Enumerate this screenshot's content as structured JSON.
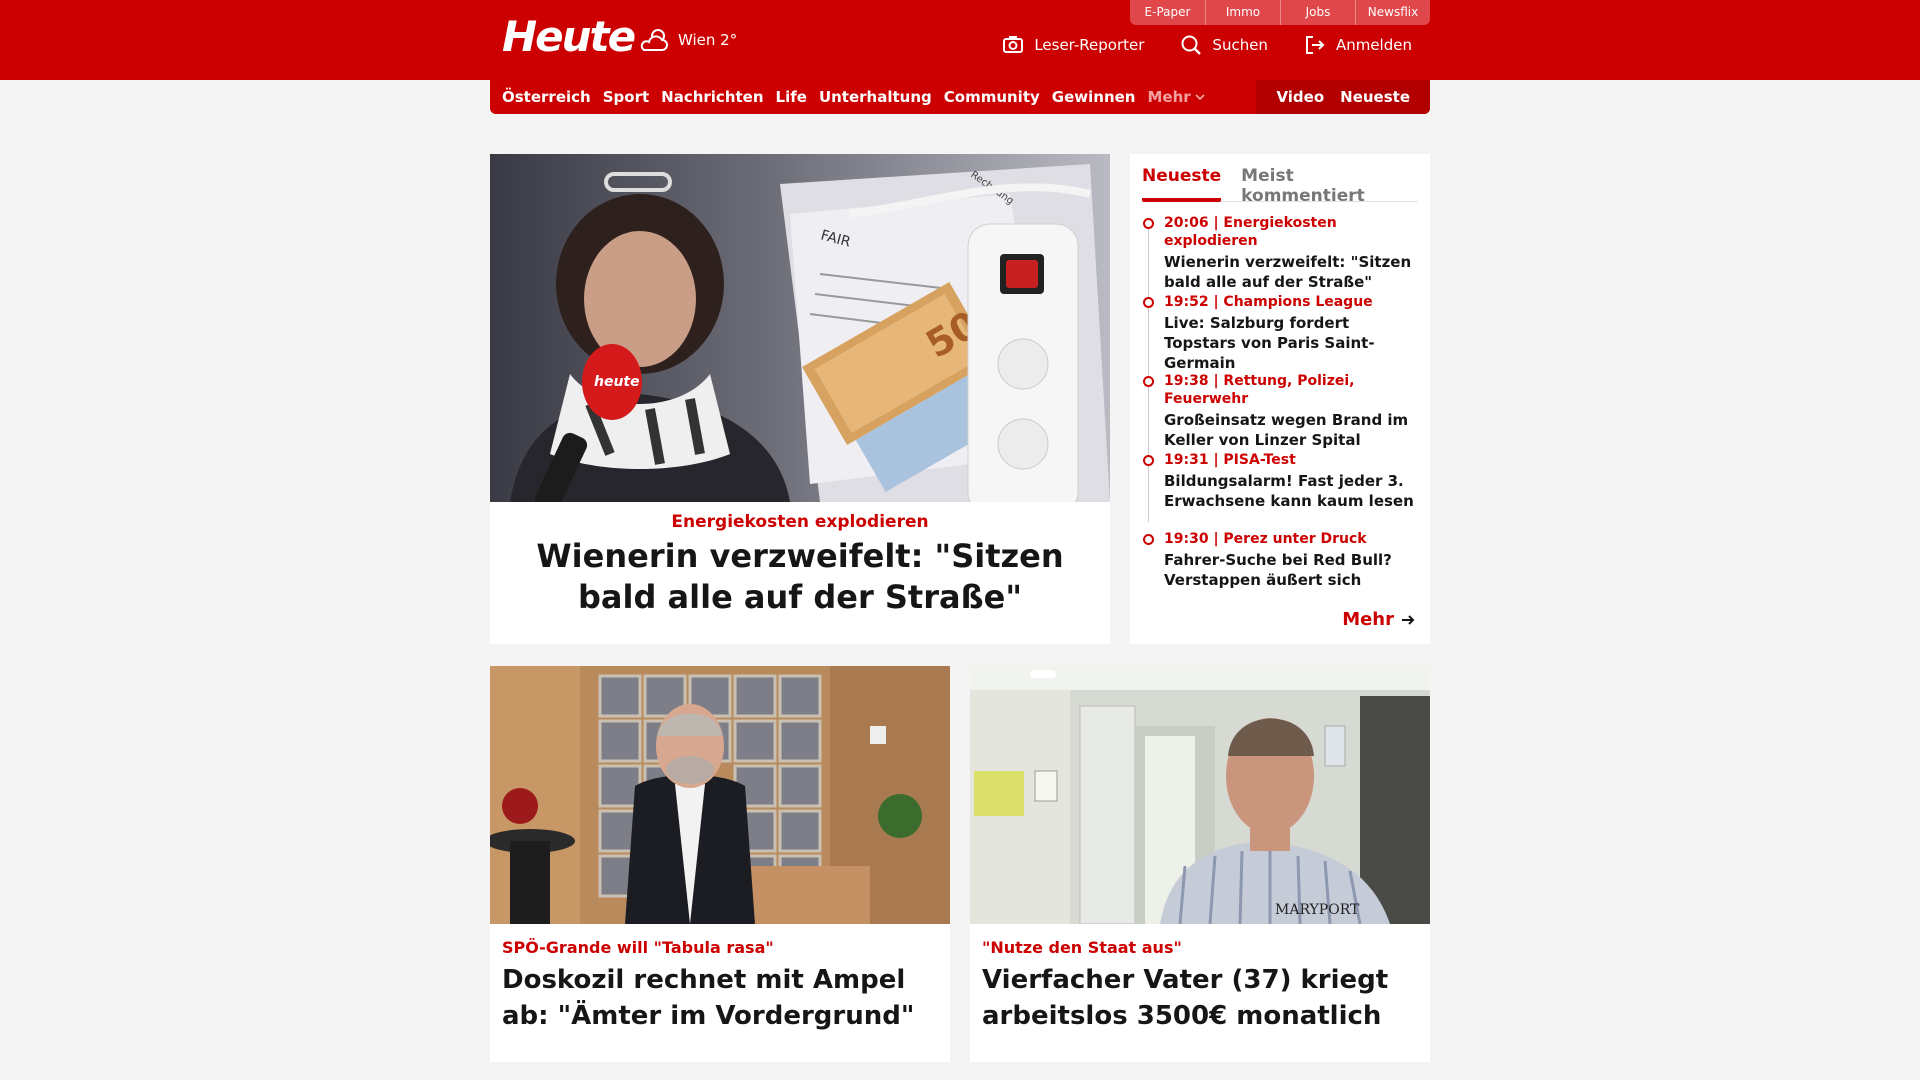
{
  "brand": {
    "logo": "Heute",
    "weather": "Wien 2°"
  },
  "quicklinks": [
    "E-Paper",
    "Immo",
    "Jobs",
    "Newsflix"
  ],
  "header_actions": {
    "reporter": "Leser-Reporter",
    "search": "Suchen",
    "login": "Anmelden"
  },
  "nav": {
    "items": [
      "Österreich",
      "Sport",
      "Nachrichten",
      "Life",
      "Unterhaltung",
      "Community",
      "Gewinnen"
    ],
    "more": "Mehr",
    "right": [
      "Video",
      "Neueste"
    ]
  },
  "hero": {
    "kicker": "Energiekosten explodieren",
    "title": "Wienerin verzweifelt: \"Sitzen bald alle auf der Straße\"",
    "image": {
      "mic_text": "heute",
      "bill_text": "FAIR",
      "sheet_label": "Rechnung",
      "banknote": "50"
    }
  },
  "sidebar": {
    "tabs": [
      "Neueste",
      "Meist kommentiert"
    ],
    "items": [
      {
        "meta": "20:06 | Energiekosten explodieren",
        "title": "Wienerin verzweifelt: \"Sitzen bald alle auf der Straße\""
      },
      {
        "meta": "19:52 | Champions League",
        "title": "Live: Salzburg fordert Topstars von Paris Saint-Germain"
      },
      {
        "meta": "19:38 | Rettung, Polizei, Feuerwehr",
        "title": "Großeinsatz wegen Brand im Keller von Linzer Spital"
      },
      {
        "meta": "19:31 | PISA-Test",
        "title": "Bildungsalarm! Fast jeder 3. Erwachsene kann kaum lesen"
      },
      {
        "meta": "19:30 | Perez unter Druck",
        "title": "Fahrer-Suche bei Red Bull? Verstappen äußert sich"
      }
    ],
    "more": "Mehr"
  },
  "cards": [
    {
      "kicker": "SPÖ-Grande will \"Tabula rasa\"",
      "title": "Doskozil rechnet mit Ampel ab: \"Ämter im Vordergrund\""
    },
    {
      "kicker": "\"Nutze den Staat aus\"",
      "title": "Vierfacher Vater (37) kriegt arbeitslos 3500€ monatlich",
      "image": {
        "shirt_text": "MARYPORT"
      }
    }
  ],
  "colors": {
    "brand_red": "#cc0000",
    "background": "#f4f4f4"
  }
}
